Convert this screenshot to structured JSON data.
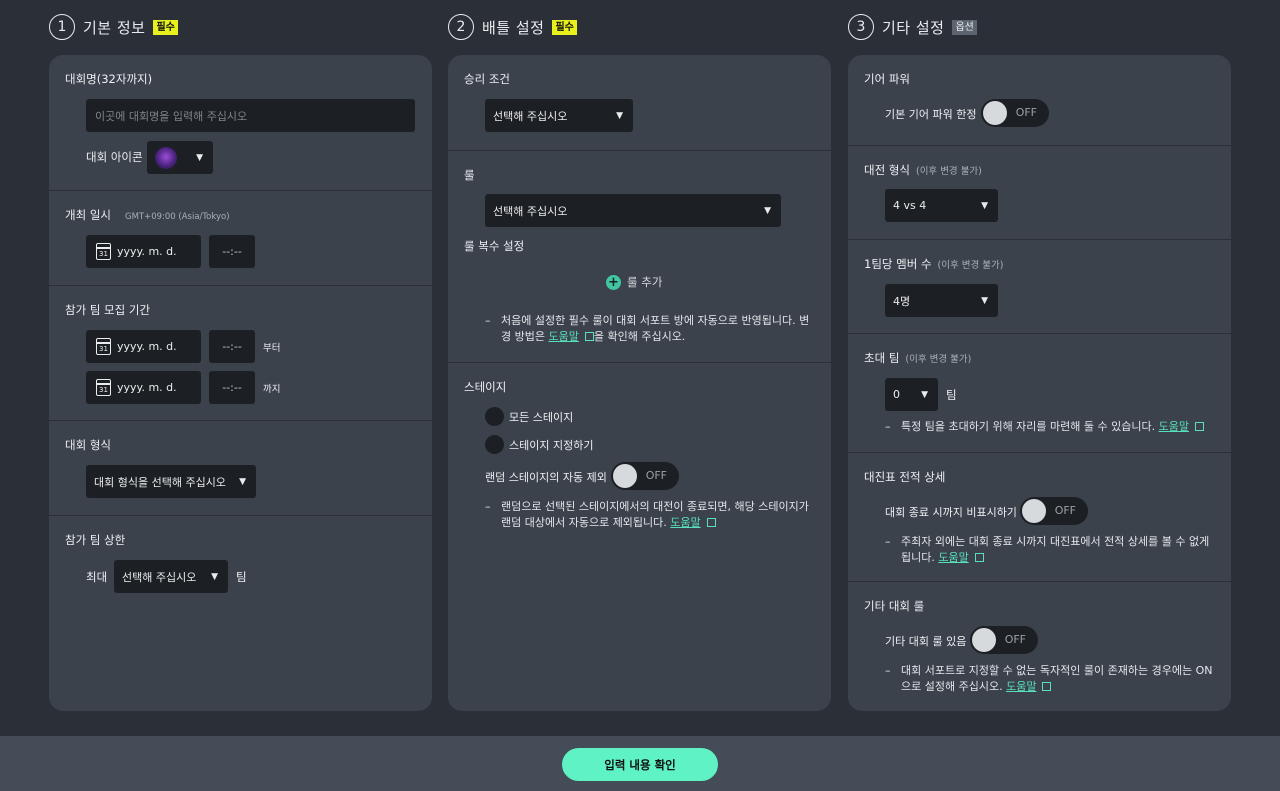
{
  "columns": [
    {
      "num": "1",
      "title": "기본 정보",
      "badge": "필수"
    },
    {
      "num": "2",
      "title": "배틀 설정",
      "badge": "필수"
    },
    {
      "num": "3",
      "title": "기타 설정",
      "badge": "옵션"
    }
  ],
  "basic": {
    "name_label": "대회명(32자까지)",
    "name_placeholder": "이곳에 대회명을 입력해 주십시오",
    "icon_label": "대회 아이콘",
    "datetime_label": "개최 일시",
    "timezone": "GMT+09:00 (Asia/Tokyo)",
    "date_placeholder": "yyyy. m. d.",
    "time_placeholder": "--:--",
    "cal_day": "31",
    "recruit_label": "참가 팀 모집 기간",
    "from_label": "부터",
    "until_label": "까지",
    "format_label": "대회 형식",
    "format_value": "대회 형식을 선택해 주십시오",
    "limit_label": "참가 팀 상한",
    "max_label": "최대",
    "limit_value": "선택해 주십시오",
    "team_unit": "팀"
  },
  "battle": {
    "win_label": "승리 조건",
    "win_value": "선택해 주십시오",
    "rule_label": "룰",
    "rule_value": "선택해 주십시오",
    "multi_rule_label": "룰 복수 설정",
    "add_rule": "룰 추가",
    "rule_note_pre": "처음에 설정한 필수 룰이 대회 서포트 방에 자동으로 반영됩니다. 변경 방법은 ",
    "rule_note_link": "도움말",
    "rule_note_post": "을 확인해 주십시오.",
    "stage_label": "스테이지",
    "stage_all": "모든 스테이지",
    "stage_custom": "스테이지 지정하기",
    "random_label": "랜덤 스테이지의 자동 제외",
    "random_toggle": "OFF",
    "stage_note": "랜덤으로 선택된 스테이지에서의 대전이 종료되면, 해당 스테이지가 랜덤 대상에서 자동으로 제외됩니다. ",
    "stage_note_link": "도움말"
  },
  "other": {
    "gear_label": "기어 파워",
    "gear_limit_label": "기본 기어 파워 한정",
    "gear_toggle": "OFF",
    "match_label": "대전 형식",
    "match_sub": "(이후 변경 불가)",
    "match_value": "4 vs 4",
    "members_label": "1팀당 멤버 수",
    "members_sub": "(이후 변경 불가)",
    "members_value": "4명",
    "invite_label": "초대 팀",
    "invite_sub": "(이후 변경 불가)",
    "invite_value": "0",
    "invite_unit": "팀",
    "invite_note": "특정 팀을 초대하기 위해 자리를 마련해 둘 수 있습니다. ",
    "invite_link": "도움말",
    "bracket_label": "대진표 전적 상세",
    "bracket_toggle_label": "대회 종료 시까지 비표시하기",
    "bracket_toggle": "OFF",
    "bracket_note": "주최자 외에는 대회 종료 시까지 대진표에서 전적 상세를 볼 수 없게 됩니다. ",
    "bracket_link": "도움말",
    "rule_label": "기타 대회 룰",
    "rule_toggle_label": "기타 대회 룰 있음",
    "rule_toggle": "OFF",
    "rule_note": "대회 서포트로 지정할 수 없는 독자적인 룰이 존재하는 경우에는 ON으로 설정해 주십시오. ",
    "rule_link": "도움말"
  },
  "footer": {
    "confirm": "입력 내용 확인"
  },
  "colors": {
    "accent": "#5ef2c4",
    "required_badge": "#e8f01e",
    "panel": "#3b424c",
    "background": "#2b3038"
  }
}
